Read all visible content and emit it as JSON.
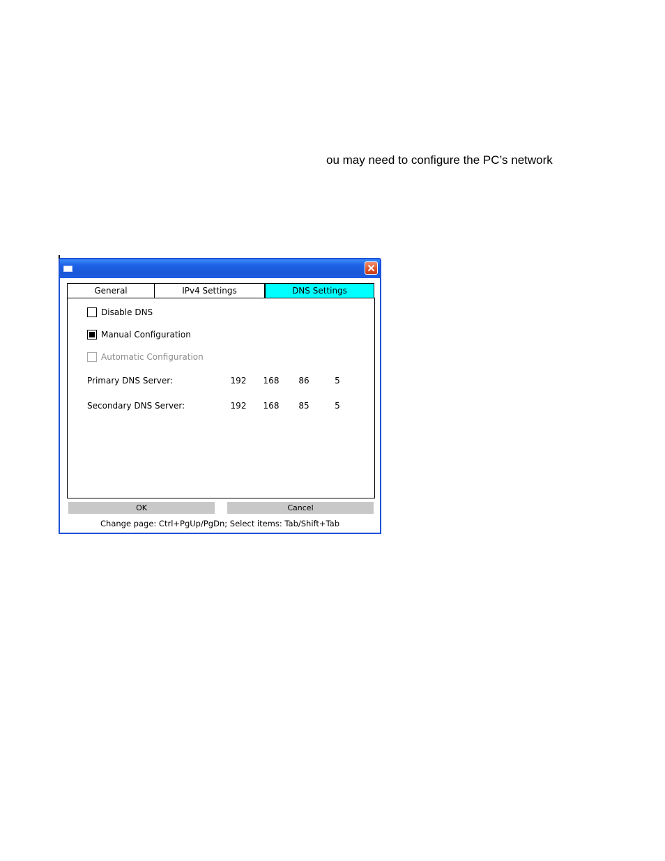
{
  "document": {
    "text_fragment": "ou may need to configure the PC’s network"
  },
  "window": {
    "title": "",
    "close_icon": "close-x-icon",
    "tabs": [
      {
        "label": "General",
        "active": false
      },
      {
        "label": "IPv4 Settings",
        "active": false
      },
      {
        "label": "DNS Settings",
        "active": true
      }
    ],
    "options": {
      "disable_dns": {
        "label": "Disable DNS",
        "checked": false,
        "enabled": true
      },
      "manual_config": {
        "label": "Manual Configuration",
        "checked": true,
        "enabled": true
      },
      "auto_config": {
        "label": "Automatic Configuration",
        "checked": false,
        "enabled": false
      }
    },
    "primary_dns": {
      "label": "Primary DNS Server:",
      "octets": [
        "192",
        "168",
        "86",
        "5"
      ]
    },
    "secondary_dns": {
      "label": "Secondary DNS Server:",
      "octets": [
        "192",
        "168",
        "85",
        "5"
      ]
    },
    "buttons": {
      "ok": "OK",
      "cancel": "Cancel"
    },
    "hint": "Change page: Ctrl+PgUp/PgDn; Select items: Tab/Shift+Tab"
  },
  "colors": {
    "titlebar": "#1f63e6",
    "active_tab": "#00ffff",
    "button_bg": "#c8c8c8",
    "close_button": "#e05a30"
  }
}
